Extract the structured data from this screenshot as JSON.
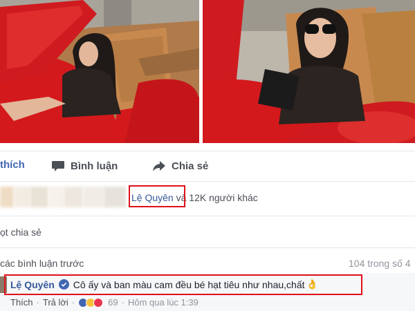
{
  "actions": {
    "like_label": "thích",
    "comment_label": "Bình luận",
    "share_label": "Chia sẻ"
  },
  "likes": {
    "name": "Lệ Quyên",
    "others_text": " và 12K người khác"
  },
  "shares": {
    "text": "ọt chia sẻ"
  },
  "comments": {
    "previous_label": "các bình luận trước",
    "count_text": "104 trong số 4",
    "item": {
      "author": "Lệ Quyên",
      "text": "Cô ấy và ban màu cam đều bé hạt tiêu như nhau,chất",
      "like_label": "Thích",
      "reply_label": "Trả lời",
      "reaction_count": "69",
      "time": "Hôm qua lúc 1:39"
    }
  },
  "colors": {
    "car_red": "#d4191c",
    "seat_tan": "#c8894f",
    "link_blue": "#365899",
    "highlight_red": "#e0101a"
  },
  "icons": {
    "comment": "speech-bubble-icon",
    "share": "share-arrow-icon",
    "verified": "verified-check-icon",
    "emoji": "ok-hand-emoji-icon"
  }
}
